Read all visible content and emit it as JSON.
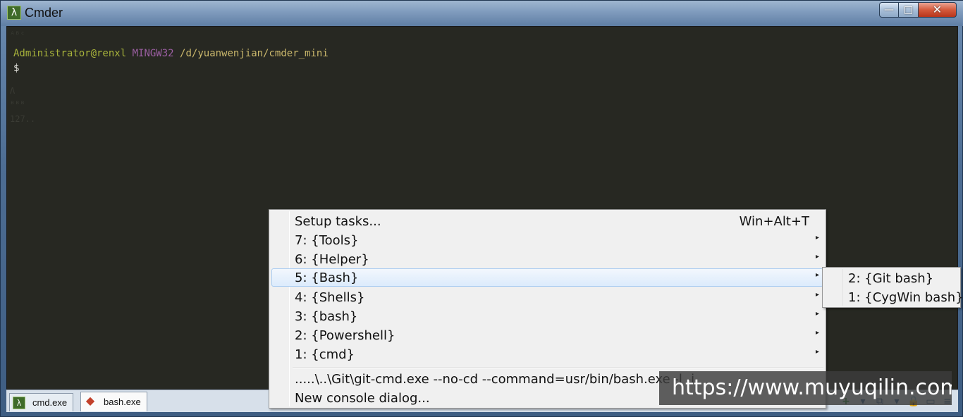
{
  "window": {
    "title": "Cmder",
    "app_icon": "λ",
    "buttons": {
      "minimize": "—",
      "maximize": "□",
      "close": "✕"
    }
  },
  "console": {
    "ghost_lines": [
      "ᴬᴮᶜ",
      "Λ",
      "ᴮᴮᴮ",
      "127.."
    ],
    "prompt": {
      "user": "Administrator@renxl",
      "env": "MINGW32",
      "path": "/d/yuanwenjian/cmder_mini",
      "dollar": "$"
    }
  },
  "tabs": [
    {
      "label": "cmd.exe",
      "icon": "λ"
    },
    {
      "label": "bash.exe",
      "icon": "◆"
    }
  ],
  "status_icons": [
    "add-console-icon",
    "dropdown-icon",
    "window-icon",
    "dropdown-icon",
    "lock-icon",
    "pane-icon",
    "menu-icon"
  ],
  "status_glyphs": [
    "+",
    "▾",
    "⧉",
    "▾",
    "🔒",
    "▭",
    "≡"
  ],
  "menu": {
    "items": [
      {
        "label": "Setup tasks...",
        "accel": "Win+Alt+T",
        "submenu": false
      },
      {
        "label": "7: {Tools}",
        "accel": "",
        "submenu": true
      },
      {
        "label": "6: {Helper}",
        "accel": "",
        "submenu": true
      },
      {
        "label": "5: {Bash}",
        "accel": "",
        "submenu": true,
        "highlighted": true
      },
      {
        "label": "4: {Shells}",
        "accel": "",
        "submenu": true
      },
      {
        "label": "3: {bash}",
        "accel": "",
        "submenu": true
      },
      {
        "label": "2: {Powershell}",
        "accel": "",
        "submenu": true
      },
      {
        "label": "1: {cmd}",
        "accel": "",
        "submenu": true
      },
      {
        "label": ".....\\..\\Git\\git-cmd.exe --no-cd --command=usr/bin/bash.exe -l -i",
        "accel": "",
        "submenu": false
      },
      {
        "label": "New console dialog...",
        "accel": "",
        "submenu": false
      }
    ],
    "arrow": "▸"
  },
  "submenu": {
    "items": [
      "2: {Git bash}",
      "1: {CygWin bash}"
    ]
  },
  "watermark": "https://www.muyuqilin.com",
  "colors": {
    "console_bg": "#272822",
    "prompt_user": "#a7b23b",
    "prompt_env": "#9c5fa3",
    "prompt_path": "#cbb86c"
  }
}
